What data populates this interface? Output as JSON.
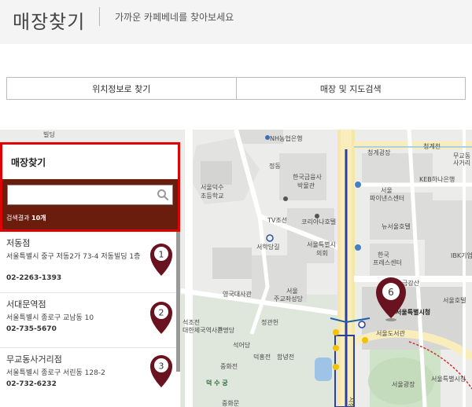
{
  "header": {
    "title": "매장찾기",
    "subtitle": "가까운 카페베네를 찾아보세요"
  },
  "tabs": [
    {
      "label": "위치정보로 찾기"
    },
    {
      "label": "매장 및 지도검색"
    }
  ],
  "panel": {
    "title": "매장찾기",
    "search_value": "",
    "search_placeholder": "",
    "result_prefix": "검색결과",
    "result_count": "10개"
  },
  "stores": [
    {
      "name": "저동점",
      "address": "서울특별시 중구 저동2가 73-4 저동빌딩 1층",
      "phone": "02-2263-1393",
      "marker": "1"
    },
    {
      "name": "서대문역점",
      "address": "서울특별시 종로구 교남동 10",
      "phone": "02-735-5670",
      "marker": "2"
    },
    {
      "name": "무교동사거리점",
      "address": "서울특별시 종로구 서린동 128-2",
      "phone": "02-732-6232",
      "marker": "3"
    }
  ],
  "map": {
    "labels": {
      "l1": "빌딩",
      "l2": "NH농협은행",
      "l3": "청계광장",
      "l4": "청계천",
      "l5": "무교동",
      "l6": "사거리",
      "l7": "정동",
      "l8": "한국금융사",
      "l9": "박물관",
      "l10": "KEB하나은행",
      "l11": "서울덕수",
      "l12": "초등학교",
      "l13": "서울",
      "l14": "파이낸스센터",
      "l15": "TV조선",
      "l16": "코리아나호텔",
      "l17": "뉴서울호텔",
      "l18": "서울특별시",
      "l19": "의회",
      "l20": "서학당길",
      "l21": "한국",
      "l22": "프레스센터",
      "l23": "IBK기업은행",
      "l24": "금강산",
      "l25": "영국대사관",
      "l26": "서울",
      "l27": "주교좌성당",
      "l28": "서울특별시청",
      "l29": "석조전",
      "l30": "대한제국역사관",
      "l31": "준명당",
      "l32": "정관헌",
      "l33": "석어당",
      "l34": "덕홍전",
      "l35": "함녕전",
      "l36": "서울도서관",
      "l37": "서울광장",
      "l38": "중화전",
      "l39": "덕 수 궁",
      "l40": "서울특별시청",
      "l41": "중화문",
      "l42": "시청",
      "l43": "서울호텔"
    },
    "marker6": "6"
  },
  "colors": {
    "accent_red": "#e00000",
    "panel_brown": "#6a1d0d",
    "pin_maroon": "#6a1320"
  }
}
